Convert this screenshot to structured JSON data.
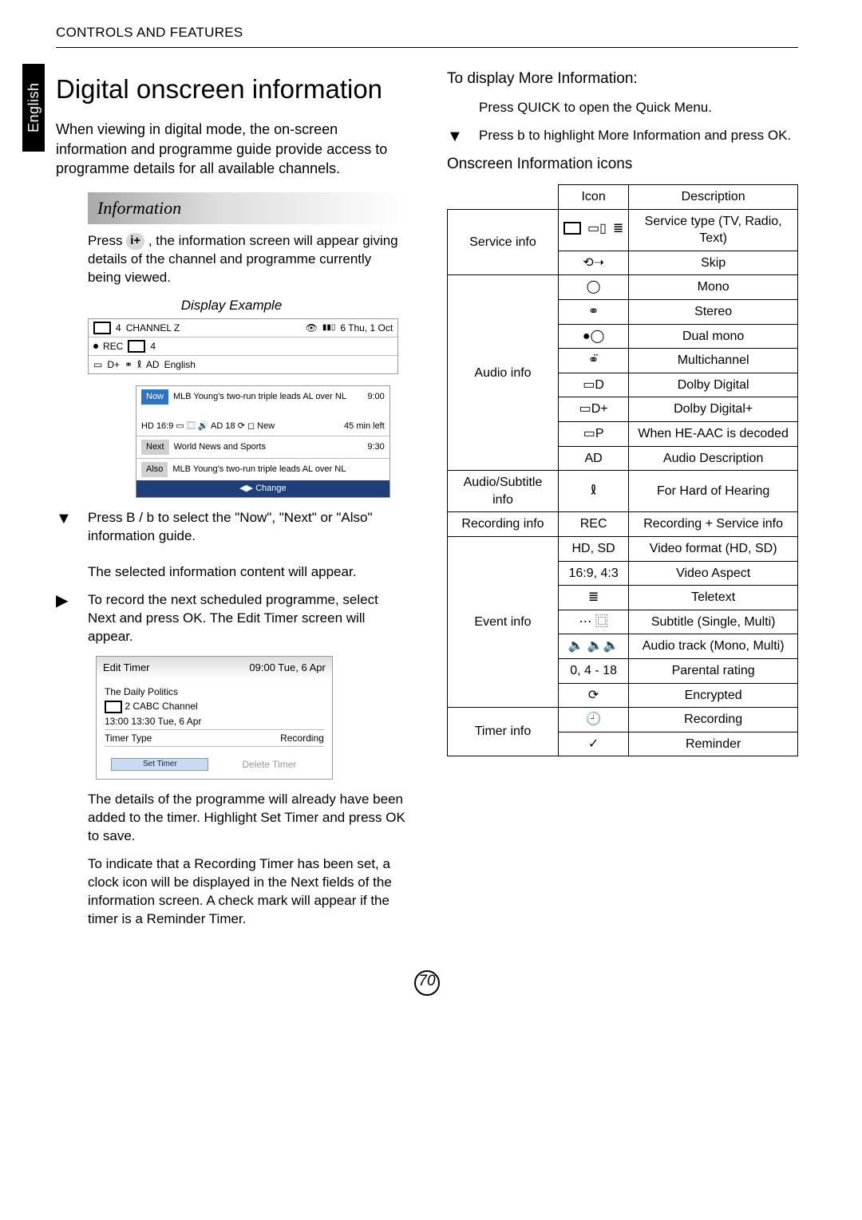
{
  "header": "CONTROLS AND FEATURES",
  "lang_tab": "English",
  "left": {
    "h1": "Digital onscreen information",
    "intro": "When viewing in digital mode, the on-screen information and programme guide provide access to programme details for all available channels.",
    "section_head": "Information",
    "info_button_label": "i+",
    "p1a": "Press ",
    "p1b": ", the information screen will appear giving details of the channel and programme currently being viewed.",
    "display_caption": "Display Example",
    "disp": {
      "ch_num": "4",
      "ch_name": "CHANNEL Z",
      "date": "6 Thu, 1 Oct",
      "rec": "REC",
      "rec_ch": "4",
      "dolby": "D+",
      "ad": "AD",
      "lang": "English"
    },
    "disp2": {
      "now": "Now",
      "now_text": "MLB Young's two-run triple leads AL over NL",
      "now_time": "9:00",
      "feat": "HD  16:9  ▭  ⿴  🔊  AD  18  ⟳  ◻  New",
      "left": "45 min left",
      "next": "Next",
      "next_text": "World News and Sports",
      "next_time": "9:30",
      "also": "Also",
      "also_text": "MLB Young's two-run triple leads AL over NL",
      "change": "◀▶ Change"
    },
    "step2": "Press B / b to select the \"Now\", \"Next\" or \"Also\" information guide.",
    "step2b": "The selected information content will appear.",
    "step3": "To record the next scheduled programme, select Next and press OK. The Edit Timer screen will appear.",
    "timer": {
      "title": "Edit Timer",
      "date": "09:00 Tue, 6 Apr",
      "prog": "The Daily Politics",
      "svc": "2 CABC Channel",
      "time": "13:00   13:30 Tue, 6 Apr",
      "type_label": "Timer Type",
      "type_val": "Recording",
      "set": "Set Timer",
      "del": "Delete Timer"
    },
    "p4": "The details of the programme will already have been added to the timer. Highlight Set Timer and press OK to save.",
    "p5": "To indicate that a Recording Timer has been set, a clock icon will be displayed in the Next fields of the information screen. A check mark will appear if the timer is a Reminder Timer."
  },
  "right": {
    "proc_head": "To display More Information:",
    "s1": "Press QUICK to open the Quick Menu.",
    "s2": "Press b to highlight More Information and press OK.",
    "icons_head": "Onscreen Information icons",
    "th_icon": "Icon",
    "th_desc": "Description",
    "rows": [
      {
        "cat": "Service info",
        "icon": "svc",
        "desc": "Service type (TV, Radio, Text)"
      },
      {
        "cat": "",
        "icon": "⟲➝",
        "desc": "Skip"
      },
      {
        "cat": "Audio info",
        "icon": "◯",
        "desc": "Mono"
      },
      {
        "cat": "",
        "icon": "⚭",
        "desc": "Stereo"
      },
      {
        "cat": "",
        "icon": "●◯",
        "desc": "Dual mono"
      },
      {
        "cat": "",
        "icon": "⚭̈",
        "desc": "Multichannel"
      },
      {
        "cat": "",
        "icon": "▭D",
        "desc": "Dolby Digital"
      },
      {
        "cat": "",
        "icon": "▭D+",
        "desc": "Dolby Digital+"
      },
      {
        "cat": "",
        "icon": "▭P",
        "desc": "When HE-AAC is decoded"
      },
      {
        "cat": "",
        "icon": "AD",
        "desc": "Audio Description"
      },
      {
        "cat": "Audio/Subtitle info",
        "icon": "𐑙",
        "desc": "For Hard of Hearing"
      },
      {
        "cat": "Recording info",
        "icon": "REC",
        "desc": "Recording + Service info"
      },
      {
        "cat": "Event info",
        "icon": "HD, SD",
        "desc": "Video format (HD, SD)"
      },
      {
        "cat": "",
        "icon": "16:9, 4:3",
        "desc": "Video Aspect"
      },
      {
        "cat": "",
        "icon": "≣",
        "desc": "Teletext"
      },
      {
        "cat": "",
        "icon": "⋯ ⿴",
        "desc": "Subtitle (Single, Multi)"
      },
      {
        "cat": "",
        "icon": "🔈 🔈🔈",
        "desc": "Audio track (Mono, Multi)"
      },
      {
        "cat": "",
        "icon": "0, 4 - 18",
        "desc": "Parental rating"
      },
      {
        "cat": "",
        "icon": "⟳",
        "desc": "Encrypted"
      },
      {
        "cat": "Timer info",
        "icon": "🕘",
        "desc": "Recording"
      },
      {
        "cat": "",
        "icon": "✓",
        "desc": "Reminder"
      }
    ]
  },
  "page_num": "70"
}
